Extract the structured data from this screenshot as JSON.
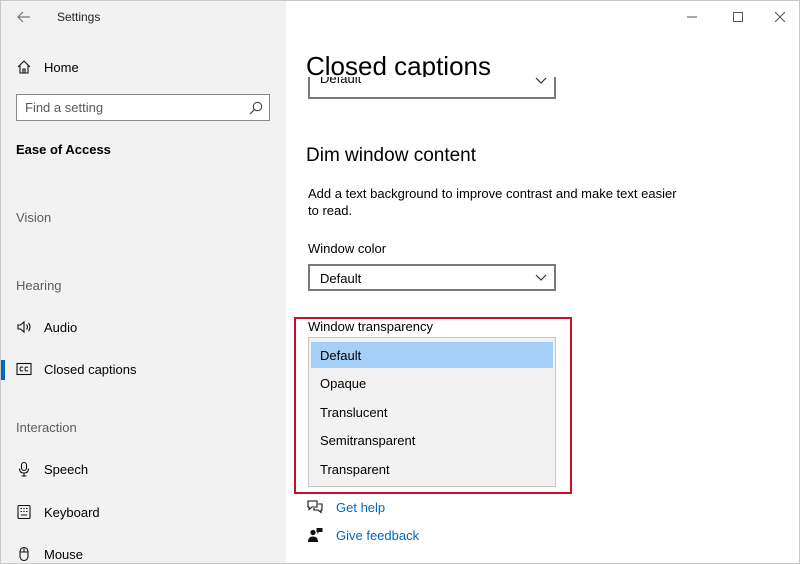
{
  "titlebar": {
    "app_title": "Settings",
    "back_icon": "arrow-left-icon",
    "buttons": [
      "minimize-icon",
      "maximize-icon",
      "close-icon"
    ]
  },
  "sidebar": {
    "home_label": "Home",
    "search": {
      "placeholder": "Find a setting",
      "value": ""
    },
    "category": "Ease of Access",
    "sections": {
      "vision": "Vision",
      "hearing": "Hearing",
      "interaction": "Interaction"
    },
    "items": [
      {
        "label": "Audio",
        "icon": "speaker-icon"
      },
      {
        "label": "Closed captions",
        "icon": "closed-captions-icon",
        "active": true
      },
      {
        "label": "Speech",
        "icon": "microphone-icon"
      },
      {
        "label": "Keyboard",
        "icon": "keyboard-icon"
      },
      {
        "label": "Mouse",
        "icon": "mouse-icon"
      }
    ]
  },
  "main": {
    "page_title": "Closed captions",
    "prev_dropdown_value": "Default",
    "section_title": "Dim window content",
    "description": "Add a text background to improve contrast and make text easier to read.",
    "window_color": {
      "label": "Window color",
      "value": "Default"
    },
    "window_transparency": {
      "label": "Window transparency",
      "options": [
        "Default",
        "Opaque",
        "Translucent",
        "Semitransparent",
        "Transparent"
      ],
      "selected": "Default"
    },
    "links": {
      "get_help": "Get help",
      "give_feedback": "Give feedback"
    }
  },
  "colors": {
    "accent": "#0067c0",
    "selected_option": "#a6cff7",
    "highlight_border": "#c8102e",
    "sidebar_bg": "#f2f2f2"
  }
}
